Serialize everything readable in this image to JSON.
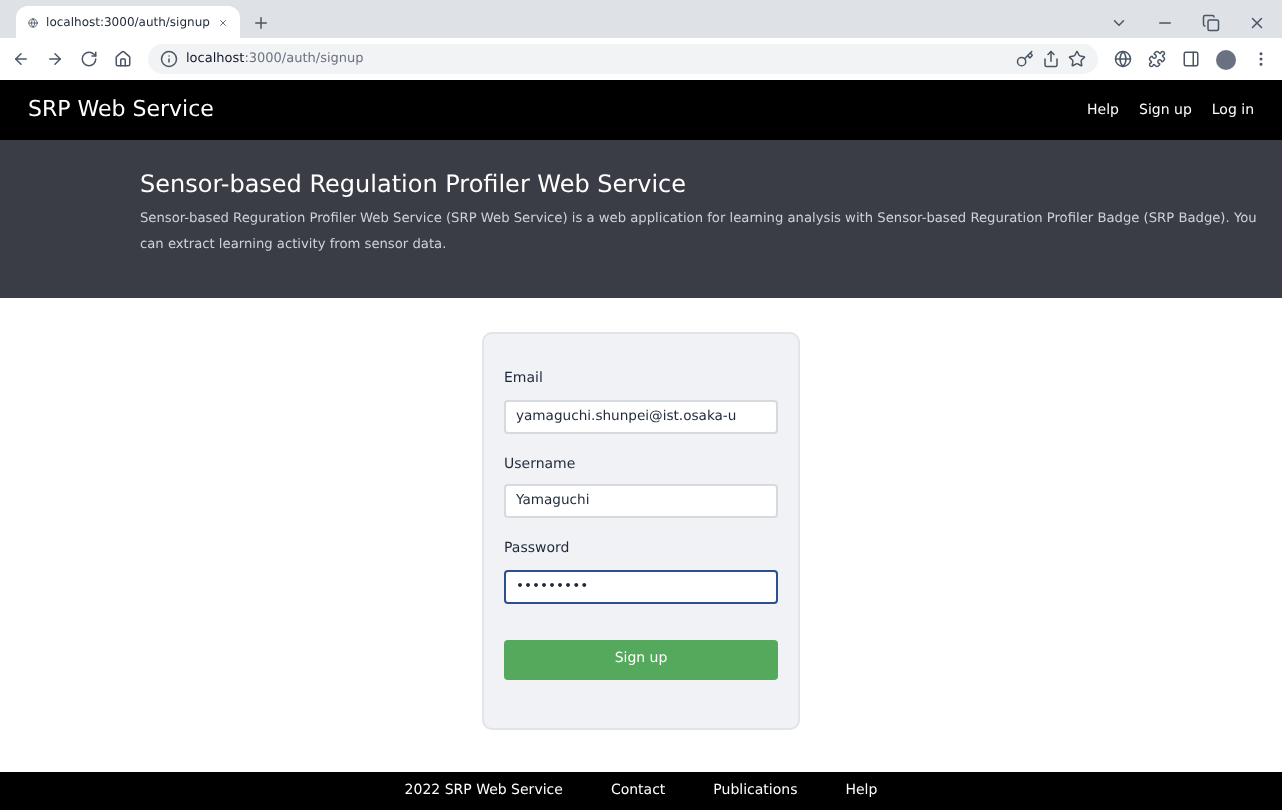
{
  "browser": {
    "tab": {
      "title": "localhost:3000/auth/signup",
      "selected": true
    },
    "address": {
      "host": "localhost",
      "path": ":3000/auth/signup"
    }
  },
  "navbar": {
    "brand": "SRP Web Service",
    "links": [
      "Help",
      "Sign up",
      "Log in"
    ]
  },
  "hero": {
    "title": "Sensor-based Regulation Profiler Web Service",
    "description": "Sensor-based Reguration Profiler Web Service (SRP Web Service) is a web application for learning analysis with Sensor-based Reguration Profiler Badge (SRP Badge). You can extract learning activity from sensor data."
  },
  "form": {
    "fields": [
      {
        "label": "Email",
        "value": "yamaguchi.shunpei@ist.osaka-u",
        "focused": false
      },
      {
        "label": "Username",
        "value": "Yamaguchi",
        "focused": false
      },
      {
        "label": "Password",
        "value": "•••••••••",
        "focused": true
      }
    ],
    "submit": "Sign up"
  },
  "footer": {
    "copyright": "2022 SRP Web Service",
    "links": [
      "Contact",
      "Publications",
      "Help"
    ]
  }
}
